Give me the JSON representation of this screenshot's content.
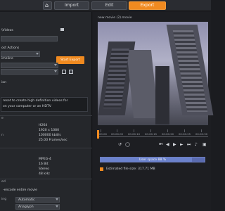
{
  "header": {
    "app_title": "",
    "tabs": [
      {
        "label": "Import"
      },
      {
        "label": "Edit"
      },
      {
        "label": "Export"
      }
    ]
  },
  "left": {
    "path_value": "\\Videos",
    "post_actions_label": "ost Actions",
    "start_export_label": "Start Export",
    "timeline_label": "imeline",
    "description_title": "ion",
    "description_line1": "reset to create high definition videos for",
    "description_line2": "on your computer or an HDTV",
    "video_codec": "H264",
    "video_resolution": "1920 x 1080",
    "video_bitrate": "100000 kbit/s",
    "video_framerate": "25.00 Frames/sec",
    "video_labels": [
      "e",
      "",
      "n",
      ""
    ],
    "audio_codec": "MPEG-4",
    "audio_bits": "16 Bit",
    "audio_channels": "Stereo",
    "audio_rate": "48 kHz",
    "audio_labels": [
      "",
      "",
      "",
      ""
    ],
    "advanced_title": "ed",
    "reencode_label": "-encode entire movie",
    "rendering_label": "ing",
    "rendering_value": "Automatic",
    "quality_value": "Anaglyph"
  },
  "preview": {
    "title": "new movie (2).movie",
    "timecodes": [
      "00:00",
      "00:00:05",
      "00:00:10",
      "00:00:15",
      "00:00:20",
      "00:00:25",
      "00:00:30"
    ],
    "user_space_text": "User space 88 %",
    "user_space_fraction": 0.88,
    "estimated_size": "Estimated file size: 317.71 MB"
  },
  "colors": {
    "accent": "#f08a20",
    "progress": "#5a6bb0"
  }
}
